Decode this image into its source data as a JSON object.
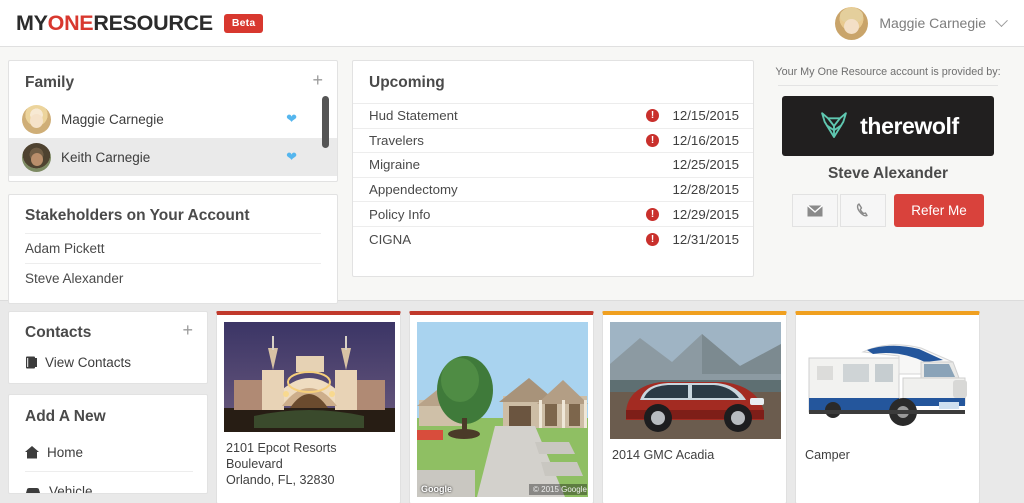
{
  "header": {
    "logo_my": "MY",
    "logo_one": "ONE",
    "logo_resource": "RESOURCE",
    "beta_label": "Beta",
    "user_name": "Maggie Carnegie",
    "avatar_name": "user-avatar",
    "chevron": "chevron-down-icon"
  },
  "family": {
    "title": "Family",
    "add_label": "+",
    "members": [
      {
        "name": "Maggie Carnegie",
        "health_icon": "heart-icon"
      },
      {
        "name": "Keith Carnegie",
        "health_icon": "heart-icon"
      }
    ]
  },
  "stakeholders": {
    "title": "Stakeholders on Your Account",
    "people": [
      {
        "name": "Adam Pickett"
      },
      {
        "name": "Steve Alexander"
      }
    ]
  },
  "upcoming": {
    "title": "Upcoming",
    "items": [
      {
        "label": "Hud Statement",
        "date": "12/15/2015",
        "alert": true
      },
      {
        "label": "Travelers",
        "date": "12/16/2015",
        "alert": true
      },
      {
        "label": "Migraine",
        "date": "12/25/2015",
        "alert": false
      },
      {
        "label": "Appendectomy",
        "date": "12/28/2015",
        "alert": false
      },
      {
        "label": "Policy Info",
        "date": "12/29/2015",
        "alert": true
      },
      {
        "label": "CIGNA",
        "date": "12/31/2015",
        "alert": true
      }
    ],
    "alert_glyph": "!"
  },
  "provider": {
    "note": "Your My One Resource account is provided by:",
    "brand_name": "therewolf",
    "brand_logo_icon": "wolf-logo-icon",
    "brand_bg_color": "#211f1f",
    "brand_accent_color": "#5fc7b0",
    "rep_name": "Steve Alexander",
    "email_icon": "envelope-icon",
    "phone_icon": "phone-icon",
    "refer_label": "Refer Me",
    "refer_color": "#d9423c"
  },
  "contacts": {
    "title": "Contacts",
    "add_label": "+",
    "view_label": "View Contacts",
    "view_icon": "address-book-icon"
  },
  "add_new": {
    "title": "Add A New",
    "items": [
      {
        "label": "Home",
        "icon": "home-icon"
      },
      {
        "label": "Vehicle",
        "icon": "car-icon"
      }
    ]
  },
  "tiles": [
    {
      "name": "epcot-resort-tile",
      "accent_color": "#c0392b",
      "caption_line1": "2101 Epcot Resorts Boulevard",
      "caption_line2": "Orlando, FL, 32830",
      "image_kind": "boardwalk-resort-photo"
    },
    {
      "name": "house-streetview-tile",
      "accent_color": "#c0392b",
      "caption_line1": "",
      "caption_line2": "",
      "image_kind": "google-streetview-house",
      "watermark": "Google",
      "copyright": "© 2015 Google"
    },
    {
      "name": "gmc-acadia-tile",
      "accent_color": "#f0a020",
      "caption_line1": "2014 GMC Acadia",
      "caption_line2": "",
      "image_kind": "red-suv-photo"
    },
    {
      "name": "camper-tile",
      "accent_color": "#f0a020",
      "caption_line1": "Camper",
      "caption_line2": "",
      "image_kind": "white-camper-photo"
    }
  ]
}
